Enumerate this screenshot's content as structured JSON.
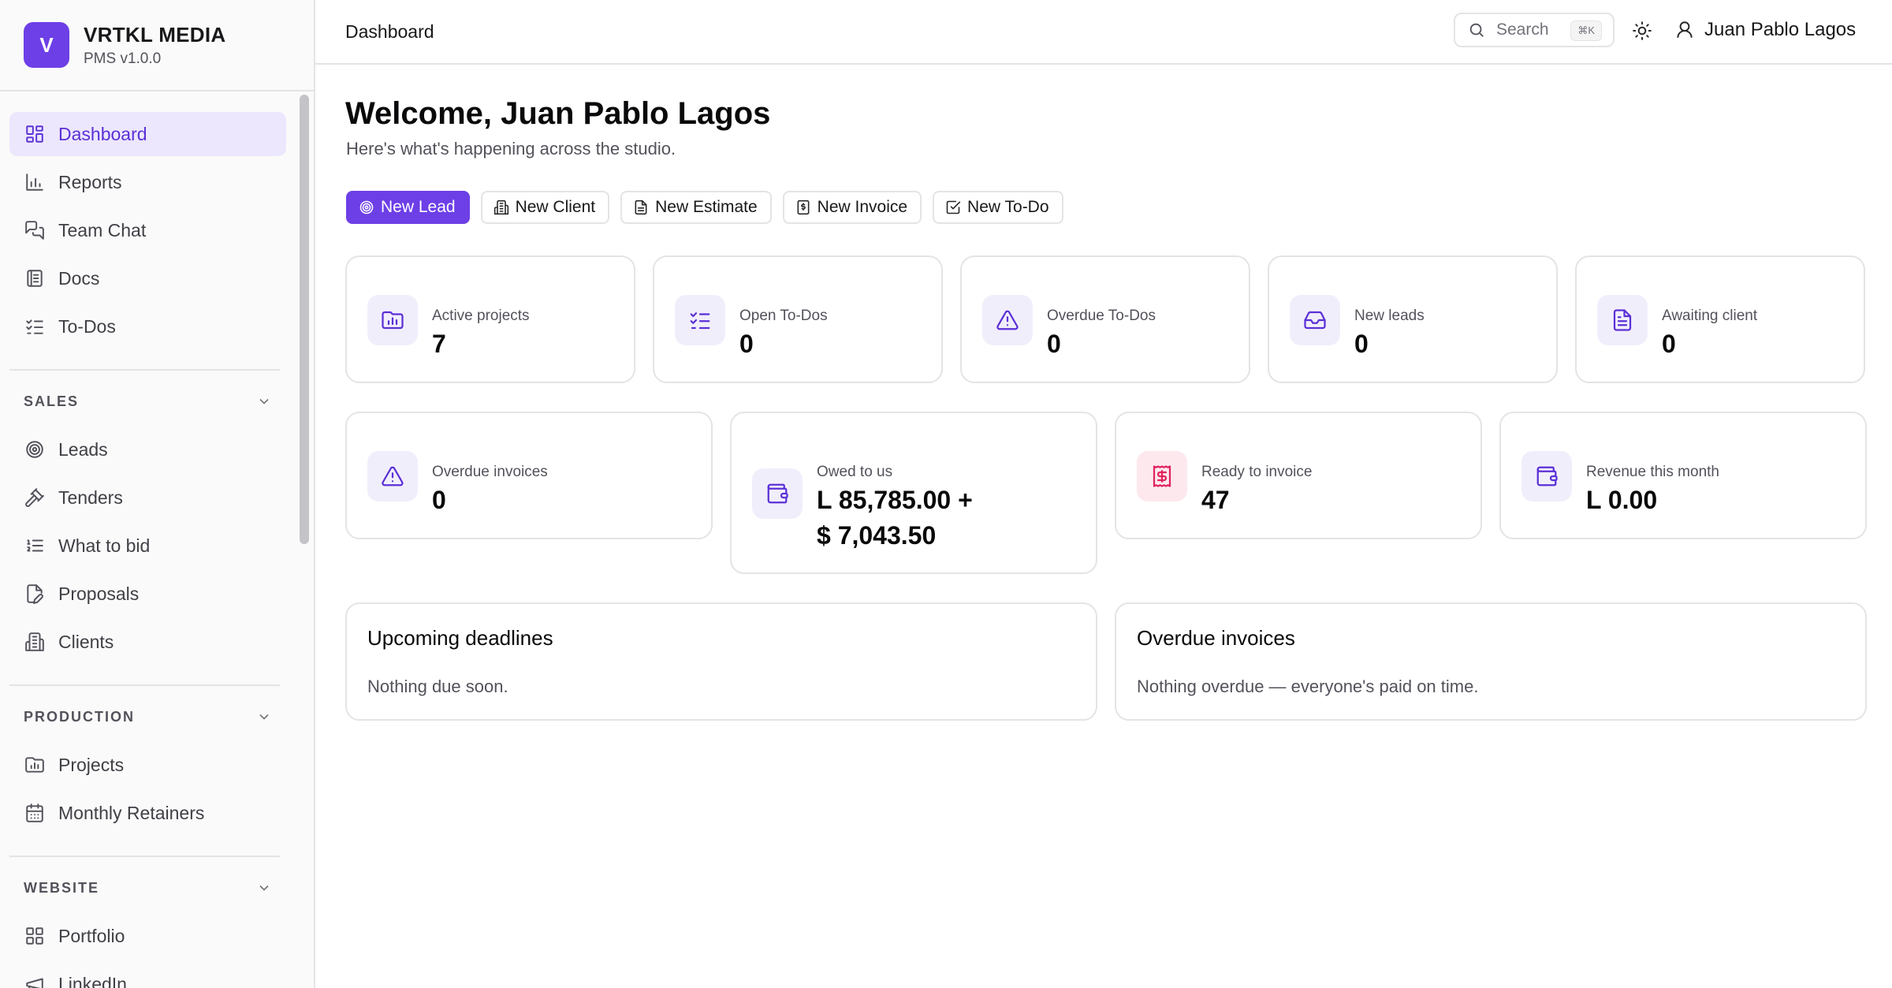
{
  "brand": {
    "logo_letter": "V",
    "name": "VRTKL MEDIA",
    "version": "PMS v1.0.0"
  },
  "sidebar": {
    "main_items": [
      {
        "label": "Dashboard",
        "icon": "dashboard-icon",
        "active": true
      },
      {
        "label": "Reports",
        "icon": "bar-chart-icon"
      },
      {
        "label": "Team Chat",
        "icon": "chat-icon"
      },
      {
        "label": "Docs",
        "icon": "docs-icon"
      },
      {
        "label": "To-Dos",
        "icon": "checklist-icon"
      }
    ],
    "sections": [
      {
        "title": "SALES",
        "items": [
          {
            "label": "Leads",
            "icon": "target-icon"
          },
          {
            "label": "Tenders",
            "icon": "gavel-icon"
          },
          {
            "label": "What to bid",
            "icon": "list-ordered-icon"
          },
          {
            "label": "Proposals",
            "icon": "file-pen-icon"
          },
          {
            "label": "Clients",
            "icon": "building-icon"
          }
        ]
      },
      {
        "title": "PRODUCTION",
        "items": [
          {
            "label": "Projects",
            "icon": "folder-chart-icon"
          },
          {
            "label": "Monthly Retainers",
            "icon": "calendar-icon"
          }
        ]
      },
      {
        "title": "WEBSITE",
        "items": [
          {
            "label": "Portfolio",
            "icon": "grid-icon"
          },
          {
            "label": "LinkedIn",
            "icon": "megaphone-icon"
          }
        ]
      }
    ]
  },
  "topbar": {
    "breadcrumb": "Dashboard",
    "search_placeholder": "Search",
    "search_shortcut": "⌘K",
    "user_name": "Juan Pablo Lagos"
  },
  "main": {
    "welcome": "Welcome, Juan Pablo Lagos",
    "subtitle": "Here's what's happening across the studio.",
    "actions": [
      {
        "label": "New Lead",
        "icon": "target-icon",
        "primary": true
      },
      {
        "label": "New Client",
        "icon": "building-icon"
      },
      {
        "label": "New Estimate",
        "icon": "file-icon"
      },
      {
        "label": "New Invoice",
        "icon": "invoice-icon"
      },
      {
        "label": "New To-Do",
        "icon": "checkbox-icon"
      }
    ],
    "stats_row1": [
      {
        "label": "Active projects",
        "value": "7",
        "icon": "folder-chart-icon"
      },
      {
        "label": "Open To-Dos",
        "value": "0",
        "icon": "checklist-icon"
      },
      {
        "label": "Overdue To-Dos",
        "value": "0",
        "icon": "warning-icon"
      },
      {
        "label": "New leads",
        "value": "0",
        "icon": "inbox-icon"
      },
      {
        "label": "Awaiting client",
        "value": "0",
        "icon": "file-text-icon"
      }
    ],
    "stats_row2": [
      {
        "label": "Overdue invoices",
        "value": "0",
        "icon": "warning-icon"
      },
      {
        "label": "Owed to us",
        "value_line1": "L 85,785.00 +",
        "value_line2": "$ 7,043.50",
        "icon": "wallet-icon"
      },
      {
        "label": "Ready to invoice",
        "value": "47",
        "icon": "receipt-icon"
      },
      {
        "label": "Revenue this month",
        "value": "L 0.00",
        "icon": "wallet-icon"
      }
    ],
    "panels": [
      {
        "title": "Upcoming deadlines",
        "empty": "Nothing due soon."
      },
      {
        "title": "Overdue invoices",
        "empty": "Nothing overdue — everyone's paid on time."
      }
    ]
  },
  "colors": {
    "accent": "#6d3fe6",
    "accent_soft": "#ece7fd",
    "danger": "#e0245e",
    "border": "#e4e4e7"
  }
}
